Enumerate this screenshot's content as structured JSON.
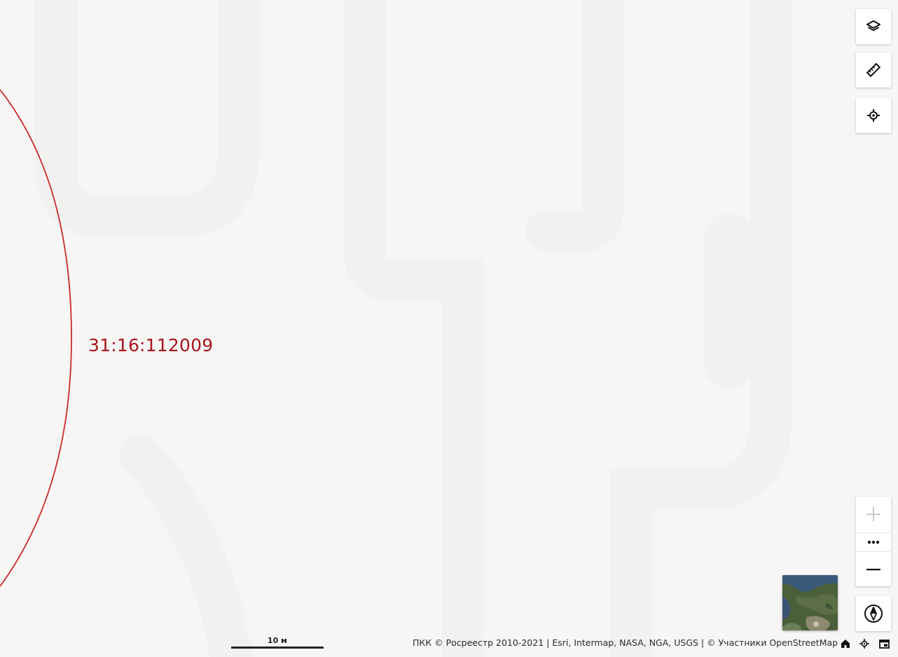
{
  "map": {
    "parcel_label": "31:16:112009",
    "parcel_color": "#a8141c",
    "boundary_color": "#cc2a2a",
    "background_color": "#f7f6f5"
  },
  "controls": {
    "layers_icon": "layers-icon",
    "ruler_icon": "ruler-icon",
    "locate_icon": "crosshair-icon",
    "zoom_in_icon": "plus-icon",
    "zoom_more_icon": "ellipsis-icon",
    "zoom_out_icon": "minus-icon",
    "compass_icon": "compass-icon",
    "basemap_icon": "satellite-thumbnail"
  },
  "scalebar": {
    "label": "10 м"
  },
  "attribution": {
    "text": "ПКК © Росреестр 2010-2021 | Esri, Intermap, NASA, NGA, USGS | © Участники OpenStreetMap"
  },
  "bottom_icons": [
    "home-icon",
    "crosshair-icon",
    "fullscreen-icon"
  ]
}
